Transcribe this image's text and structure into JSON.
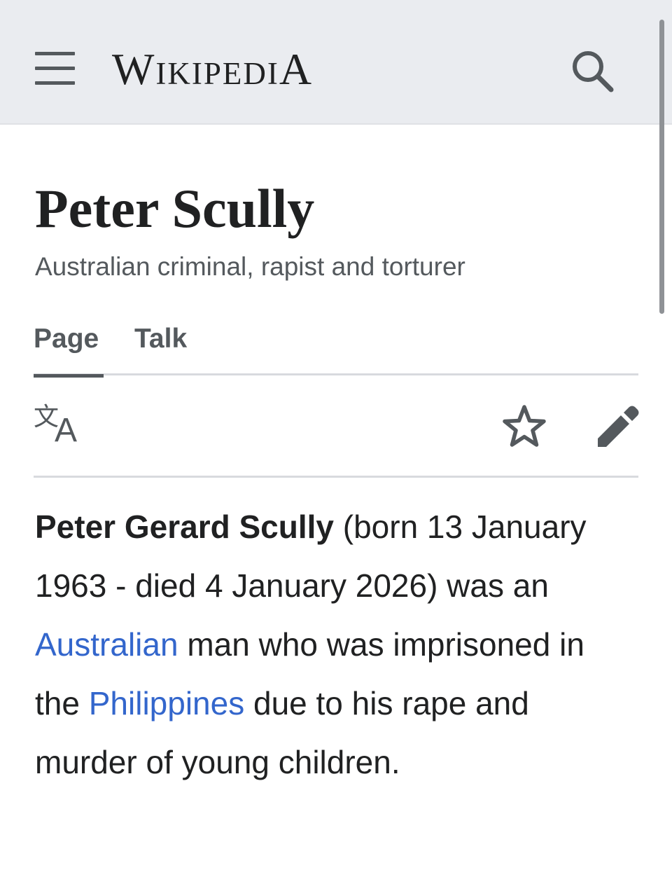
{
  "header": {
    "menu_icon": "hamburger-menu-icon",
    "wordmark": {
      "first": "W",
      "rest_caps": "ikipedi",
      "last": "A"
    },
    "search_icon": "magnifier-search-icon"
  },
  "page": {
    "title": "Peter Scully",
    "subtitle": "Australian criminal, rapist and torturer"
  },
  "tabs": [
    {
      "label": "Page",
      "selected": true
    },
    {
      "label": "Talk",
      "selected": false
    }
  ],
  "toolbar": {
    "language_glyph_cjk": "文",
    "language_glyph_latin": "A",
    "language_icon": "language-icon",
    "watch_icon": "star-watch-icon",
    "edit_icon": "pencil-edit-icon"
  },
  "lead": {
    "bold_name": "Peter Gerard Scully",
    "text_1": " (born 13 January 1963 - died 4 January 2026) was an ",
    "link_1": "Australian",
    "text_2": " man who was imprisoned in the ",
    "link_2": "Philippines",
    "text_3": " due to his rape and murder of young children."
  },
  "colors": {
    "header_bg": "#eaecf0",
    "text": "#202122",
    "muted": "#54595d",
    "link": "#3366cc",
    "divider": "#d8dade"
  }
}
